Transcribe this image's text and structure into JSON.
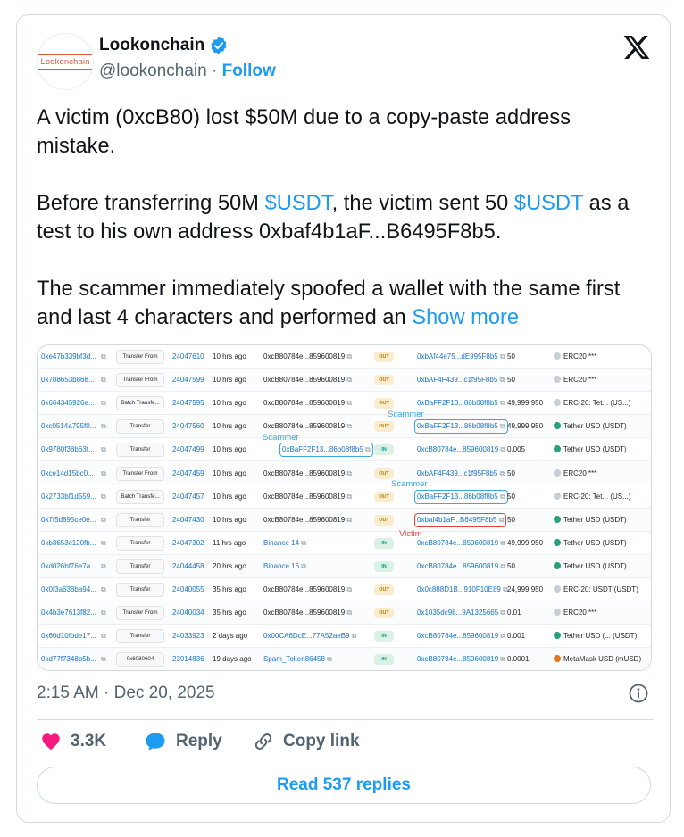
{
  "author": {
    "avatar_text": "Lookonchain",
    "display_name": "Lookonchain",
    "handle": "@lookonchain",
    "separator": " · ",
    "follow_label": "Follow"
  },
  "tweet": {
    "text_segments": [
      {
        "text": "A victim (0xcB80) lost $50M due to a copy-paste address mistake.\n\nBefore transferring 50M ",
        "type": "text"
      },
      {
        "text": "$USDT",
        "type": "cashtag"
      },
      {
        "text": ", the victim sent 50 ",
        "type": "text"
      },
      {
        "text": "$USDT",
        "type": "cashtag"
      },
      {
        "text": " as a test to his own address 0xbaf4b1aF...B6495F8b5.\n\nThe scammer immediately spoofed a wallet with the same first and last 4 characters and performed an ",
        "type": "text"
      }
    ],
    "show_more_label": "Show more"
  },
  "media": {
    "copy_glyph": "⧉",
    "rows": [
      {
        "hash": "0xe47b339bf3d...",
        "method": "Transfer From",
        "block": "24047610",
        "age": "10 hrs ago",
        "from": "0xcB80784e...859600819",
        "dir": "OUT",
        "to": "0xbAf44e75...dE995F8b5",
        "value": "50",
        "token_icon": "generic",
        "token": "ERC20 ***"
      },
      {
        "hash": "0x788653b868...",
        "method": "Transfer From",
        "block": "24047599",
        "age": "10 hrs ago",
        "from": "0xcB80784e...859600819",
        "dir": "OUT",
        "to": "0xbAF4F439...c1f95F8b5",
        "value": "50",
        "token_icon": "generic",
        "token": "ERC20 ***"
      },
      {
        "hash": "0x664345926e...",
        "method": "Batch Transfe...",
        "block": "24047595",
        "age": "10 hrs ago",
        "from": "0xcB80784e...859600819",
        "dir": "OUT",
        "to": "0xBaFF2F13...86b08f8b5",
        "value": "49,999,950",
        "token_icon": "generic",
        "token": "ERC-20: Tet... (US...)"
      },
      {
        "hash": "0xc0514a795f0...",
        "method": "Transfer",
        "block": "24047560",
        "age": "10 hrs ago",
        "from": "0xcB80784e...859600819",
        "dir": "OUT",
        "to": "0xBaFF2F13...86b08f8b5",
        "to_style": "blue",
        "value": "49,999,950",
        "token_icon": "tether",
        "token": "Tether USD (USDT)"
      },
      {
        "hash": "0x9780f38b63f...",
        "method": "Transfer",
        "block": "24047499",
        "age": "10 hrs ago",
        "from": "0xBaFF2F13...86b08f8b5",
        "from_style": "blue",
        "dir": "IN",
        "to": "0xcB80784e...859600819",
        "value": "0.005",
        "token_icon": "tether",
        "token": "Tether USD (USDT)"
      },
      {
        "hash": "0xce14d15bc0...",
        "method": "Transfer From",
        "block": "24047459",
        "age": "10 hrs ago",
        "from": "0xcB80784e...859600819",
        "dir": "OUT",
        "to": "0xbAF4F439...c1f95F8b5",
        "value": "50",
        "token_icon": "generic",
        "token": "ERC20 ***"
      },
      {
        "hash": "0x2733bf1d559...",
        "method": "Batch Transfe...",
        "block": "24047457",
        "age": "10 hrs ago",
        "from": "0xcB80784e...859600819",
        "dir": "OUT",
        "to": "0xBaFF2F13...86b08f8b5",
        "to_style": "blue",
        "value": "50",
        "token_icon": "generic",
        "token": "ERC-20: Tet... (US...)"
      },
      {
        "hash": "0x7f5d895ce0e...",
        "method": "Transfer",
        "block": "24047430",
        "age": "10 hrs ago",
        "from": "0xcB80784e...859600819",
        "dir": "OUT",
        "to": "0xbaf4b1aF...B6495F8b5",
        "to_style": "red",
        "value": "50",
        "token_icon": "tether",
        "token": "Tether USD (USDT)"
      },
      {
        "hash": "0xb3653c120fb...",
        "method": "Transfer",
        "block": "24047302",
        "age": "11 hrs ago",
        "from": "Binance 14",
        "from_style": "link",
        "dir": "IN",
        "to": "0xcB80784e...859600819",
        "value": "49,999,950",
        "token_icon": "tether",
        "token": "Tether USD (USDT)"
      },
      {
        "hash": "0xd026bf76e7a...",
        "method": "Transfer",
        "block": "24044458",
        "age": "20 hrs ago",
        "from": "Binance 16",
        "from_style": "link",
        "dir": "IN",
        "to": "0xcB80784e...859600819",
        "value": "50",
        "token_icon": "tether",
        "token": "Tether USD (USDT)"
      },
      {
        "hash": "0x0f3a638ba94...",
        "method": "Transfer",
        "block": "24040055",
        "age": "35 hrs ago",
        "from": "0xcB80784e...859600819",
        "dir": "OUT",
        "to": "0x0c888D1B...910F10E89",
        "value": "24,999,950",
        "token_icon": "generic",
        "token": "ERC-20: USDT (USDT)"
      },
      {
        "hash": "0x4b3e7613f82...",
        "method": "Transfer From",
        "block": "24040034",
        "age": "35 hrs ago",
        "from": "0xcB80784e...859600819",
        "dir": "OUT",
        "to": "0x1035dc98...9A1325665",
        "value": "0.01",
        "token_icon": "generic",
        "token": "ERC20 ***"
      },
      {
        "hash": "0x60d10fbde17...",
        "method": "Transfer",
        "block": "24033923",
        "age": "2 days ago",
        "from": "0x00CA6DcE...77A52aeB9",
        "from_style": "link",
        "dir": "IN",
        "to": "0xcB80784e...859600819",
        "value": "0.001",
        "token_icon": "tether",
        "token": "Tether USD (... (USDT)"
      },
      {
        "hash": "0xd77f7348b5b...",
        "method": "0x6080604",
        "block": "23914836",
        "age": "19 days ago",
        "from": "Spam_Token86458",
        "from_style": "link",
        "dir": "IN",
        "to": "0xcB80784e...859600819",
        "value": "0.0001",
        "token_icon": "mm",
        "token": "MetaMask USD (mUSD)"
      }
    ],
    "annotations": {
      "scammer": "Scammer",
      "victim": "Victim"
    }
  },
  "meta": {
    "timestamp": "2:15 AM · Dec 20, 2025"
  },
  "actions": {
    "like_count": "3.3K",
    "reply_label": "Reply",
    "copy_link_label": "Copy link",
    "read_replies_label": "Read 537 replies"
  },
  "colors": {
    "accent": "#1d9bf0",
    "like": "#f91880",
    "verified": "#1d9bf0",
    "scammer_box": "#3ba7e5",
    "victim_box": "#e0443a"
  }
}
